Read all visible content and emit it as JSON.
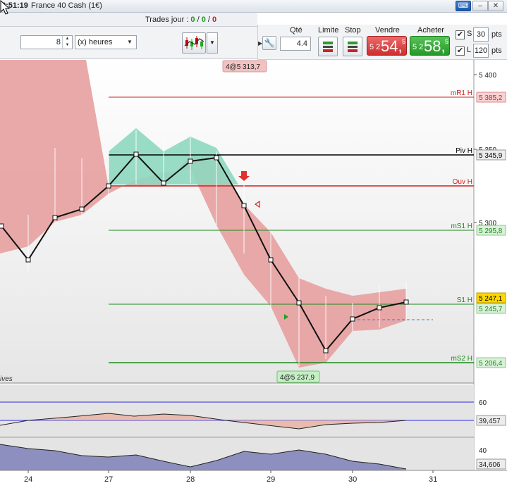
{
  "window": {
    "time": "8:51:19",
    "instrument": "France 40 Cash (1€)"
  },
  "trades": {
    "label": "Trades jour : ",
    "a": "0",
    "sep1": " / ",
    "b": "0",
    "sep2": " / ",
    "c": "0"
  },
  "toolbar": {
    "period_value": "8",
    "period_unit": "(x) heures"
  },
  "order": {
    "qty_label": "Qté",
    "qty_value": "4.4",
    "limit_label": "Limite",
    "stop_label": "Stop",
    "sell_label": "Vendre",
    "sell_small": "5 2",
    "sell_big": "54,",
    "sell_sup": "5",
    "buy_label": "Acheter",
    "buy_small": "5 2",
    "buy_big": "58,",
    "buy_sup": "5",
    "s_label": "S",
    "s_value": "30",
    "l_label": "L",
    "l_value": "120",
    "pts": "pts"
  },
  "chart": {
    "price_ticks": [
      "5 400",
      "5 350",
      "5 300"
    ],
    "levels": [
      {
        "name": "mR1 H",
        "value": "5 385,2",
        "color": "#cc2222"
      },
      {
        "name": "Piv H",
        "value": "5 345,9",
        "color": "#000000"
      },
      {
        "name": "Ouv H",
        "value": "",
        "color": "#cc2222"
      },
      {
        "name": "mS1 H",
        "value": "5 295,8",
        "color": "#1a8a1a"
      },
      {
        "name": "S1 H",
        "value": "5 245,7",
        "color": "#1a8a1a"
      },
      {
        "name": "mS2 H",
        "value": "5 206,4",
        "color": "#1a8a1a"
      }
    ],
    "current_price": "5 247,1",
    "high_label": "4@5 313,7",
    "low_label": "4@5 237,9",
    "corner_label": "ives",
    "osc1": {
      "tick": "60",
      "value": "39,457"
    },
    "osc2": {
      "tick": "40",
      "value": "34,606"
    },
    "dates": [
      "24",
      "27",
      "28",
      "29",
      "30",
      "31"
    ]
  },
  "colors": {
    "sell": "#cf2e2e",
    "buy": "#249a26",
    "band_red": "#e8a0a0",
    "band_green": "#8ed8c0"
  }
}
